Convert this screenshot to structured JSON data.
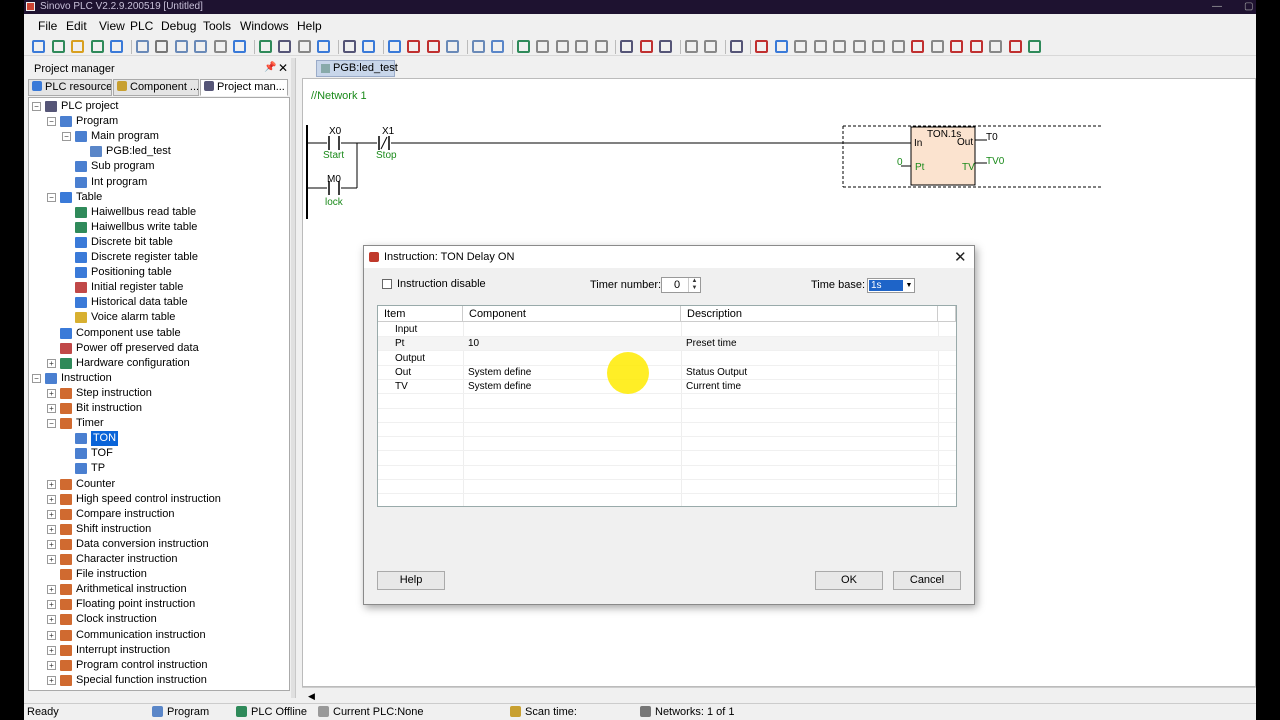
{
  "window": {
    "title": "Sinovo PLC V2.2.9.200519 [Untitled]"
  },
  "menu": [
    "File",
    "Edit",
    "View",
    "PLC",
    "Debug",
    "Tools",
    "Windows",
    "Help"
  ],
  "project_manager": {
    "title": "Project manager",
    "tabs": [
      "PLC resources",
      "Component ...",
      "Project man..."
    ],
    "tree": [
      {
        "label": "PLC project",
        "level": 0,
        "exp": "-",
        "icon": "plc-project-icon",
        "color": "#557"
      },
      {
        "label": "Program",
        "level": 1,
        "exp": "-",
        "icon": "program-folder-icon",
        "color": "#4a7fd0"
      },
      {
        "label": "Main program",
        "level": 2,
        "exp": "-",
        "icon": "main-program-icon",
        "color": "#4a7fd0"
      },
      {
        "label": "PGB:led_test",
        "level": 3,
        "exp": "",
        "icon": "program-block-icon",
        "color": "#5a86c8"
      },
      {
        "label": "Sub program",
        "level": 2,
        "exp": "",
        "icon": "sub-program-icon",
        "color": "#4a7fd0"
      },
      {
        "label": "Int program",
        "level": 2,
        "exp": "",
        "icon": "int-program-icon",
        "color": "#4a7fd0"
      },
      {
        "label": "Table",
        "level": 1,
        "exp": "-",
        "icon": "table-icon",
        "color": "#3a7ad8"
      },
      {
        "label": "Haiwellbus read table",
        "level": 2,
        "exp": "",
        "icon": "read-table-icon",
        "color": "#2f8a5a"
      },
      {
        "label": "Haiwellbus write table",
        "level": 2,
        "exp": "",
        "icon": "write-table-icon",
        "color": "#2f8a5a"
      },
      {
        "label": "Discrete bit table",
        "level": 2,
        "exp": "",
        "icon": "bit-table-icon",
        "color": "#3a7ad8"
      },
      {
        "label": "Discrete register table",
        "level": 2,
        "exp": "",
        "icon": "register-table-icon",
        "color": "#3a7ad8"
      },
      {
        "label": "Positioning table",
        "level": 2,
        "exp": "",
        "icon": "positioning-table-icon",
        "color": "#3a7ad8"
      },
      {
        "label": "Initial register table",
        "level": 2,
        "exp": "",
        "icon": "initial-register-icon",
        "color": "#c04848"
      },
      {
        "label": "Historical data table",
        "level": 2,
        "exp": "",
        "icon": "historical-data-icon",
        "color": "#3a7ad8"
      },
      {
        "label": "Voice alarm table",
        "level": 2,
        "exp": "",
        "icon": "voice-alarm-icon",
        "color": "#d8b030"
      },
      {
        "label": "Component use table",
        "level": 1,
        "exp": "",
        "icon": "component-use-icon",
        "color": "#3a7ad8"
      },
      {
        "label": "Power off preserved data",
        "level": 1,
        "exp": "",
        "icon": "power-off-icon",
        "color": "#c04848"
      },
      {
        "label": "Hardware configuration",
        "level": 1,
        "exp": "+",
        "icon": "hardware-icon",
        "color": "#2f8a5a"
      },
      {
        "label": "Instruction",
        "level": 0,
        "exp": "-",
        "icon": "instruction-icon",
        "color": "#4a7fd0"
      },
      {
        "label": "Step instruction",
        "level": 1,
        "exp": "+",
        "icon": "step-instruction-icon",
        "color": "#d06a30"
      },
      {
        "label": "Bit instruction",
        "level": 1,
        "exp": "+",
        "icon": "bit-instruction-icon",
        "color": "#d06a30"
      },
      {
        "label": "Timer",
        "level": 1,
        "exp": "-",
        "icon": "timer-icon",
        "color": "#d06a30"
      },
      {
        "label": "TON",
        "level": 2,
        "exp": "",
        "icon": "ton-icon",
        "color": "#4a7fd0",
        "selected": true
      },
      {
        "label": "TOF",
        "level": 2,
        "exp": "",
        "icon": "tof-icon",
        "color": "#4a7fd0"
      },
      {
        "label": "TP",
        "level": 2,
        "exp": "",
        "icon": "tp-icon",
        "color": "#4a7fd0"
      },
      {
        "label": "Counter",
        "level": 1,
        "exp": "+",
        "icon": "counter-icon",
        "color": "#d06a30"
      },
      {
        "label": "High speed control instruction",
        "level": 1,
        "exp": "+",
        "icon": "high-speed-icon",
        "color": "#d06a30"
      },
      {
        "label": "Compare instruction",
        "level": 1,
        "exp": "+",
        "icon": "compare-icon",
        "color": "#d06a30"
      },
      {
        "label": "Shift instruction",
        "level": 1,
        "exp": "+",
        "icon": "shift-icon",
        "color": "#d06a30"
      },
      {
        "label": "Data conversion instruction",
        "level": 1,
        "exp": "+",
        "icon": "data-conversion-icon",
        "color": "#d06a30"
      },
      {
        "label": "Character instruction",
        "level": 1,
        "exp": "+",
        "icon": "character-icon",
        "color": "#d06a30"
      },
      {
        "label": "File instruction",
        "level": 1,
        "exp": "",
        "icon": "file-instruction-icon",
        "color": "#d06a30"
      },
      {
        "label": "Arithmetical instruction",
        "level": 1,
        "exp": "+",
        "icon": "arithmetical-icon",
        "color": "#d06a30"
      },
      {
        "label": "Floating point instruction",
        "level": 1,
        "exp": "+",
        "icon": "floating-point-icon",
        "color": "#d06a30"
      },
      {
        "label": "Clock instruction",
        "level": 1,
        "exp": "+",
        "icon": "clock-icon",
        "color": "#d06a30"
      },
      {
        "label": "Communication instruction",
        "level": 1,
        "exp": "+",
        "icon": "communication-icon",
        "color": "#d06a30"
      },
      {
        "label": "Interrupt instruction",
        "level": 1,
        "exp": "+",
        "icon": "interrupt-icon",
        "color": "#d06a30"
      },
      {
        "label": "Program control instruction",
        "level": 1,
        "exp": "+",
        "icon": "program-control-icon",
        "color": "#d06a30"
      },
      {
        "label": "Special function instruction",
        "level": 1,
        "exp": "+",
        "icon": "special-function-icon",
        "color": "#d06a30"
      }
    ]
  },
  "editor": {
    "tab": "PGB:led_test",
    "network_label": "//Network 1",
    "contacts": [
      {
        "addr": "X0",
        "name": "Start"
      },
      {
        "addr": "X1",
        "name": "Stop"
      },
      {
        "addr": "M0",
        "name": "lock"
      }
    ],
    "block": {
      "title": "TON.1s",
      "in": "In",
      "out": "Out",
      "pt": "Pt",
      "tv": "TV",
      "pt_value": "0",
      "out_target": "T0",
      "tv_target": "TV0"
    }
  },
  "dialog": {
    "title": "Instruction: TON Delay ON",
    "instruction_disable": "Instruction disable",
    "timer_number_label": "Timer number:",
    "timer_number": "0",
    "time_base_label": "Time base:",
    "time_base": "1s",
    "columns": [
      "Item",
      "Component",
      "Description"
    ],
    "rows": [
      {
        "item": "Input",
        "component": "",
        "description": "",
        "group": true
      },
      {
        "item": "Pt",
        "component": "10",
        "description": "Preset time",
        "group": false
      },
      {
        "item": "Output",
        "component": "",
        "description": "",
        "group": true
      },
      {
        "item": "Out",
        "component": "System define",
        "description": "Status Output",
        "group": false
      },
      {
        "item": "TV",
        "component": "System define",
        "description": "Current time",
        "group": false
      }
    ],
    "help": "Help",
    "ok": "OK",
    "cancel": "Cancel"
  },
  "status": {
    "ready": "Ready",
    "program": "Program",
    "plc_offline": "PLC Offline",
    "current_plc": "Current PLC:None",
    "scan_time": "Scan time:",
    "networks": "Networks:  1 of 1"
  },
  "colors": {
    "ladder_green": "#1a8a1a",
    "block_fill": "#fbe3cf",
    "selection": "#0a64d8",
    "highlight": "#ffeb00"
  }
}
